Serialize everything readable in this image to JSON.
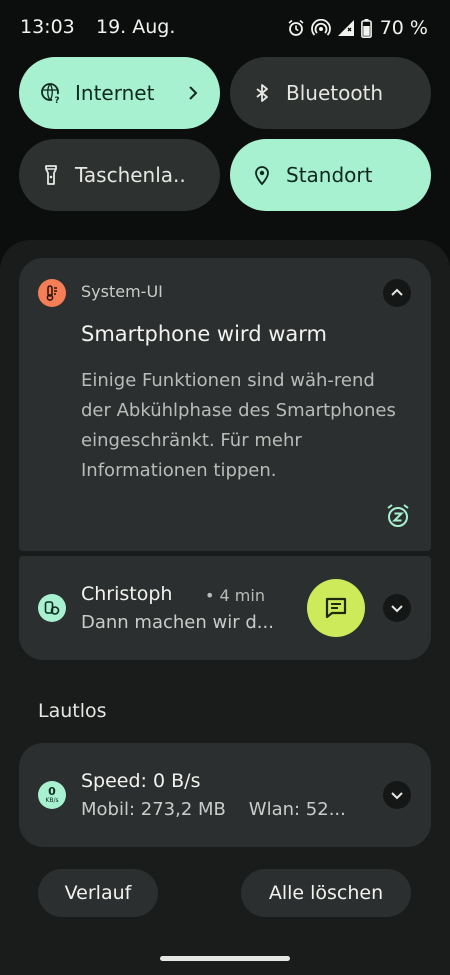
{
  "status_bar": {
    "time": "13:03",
    "date": "19. Aug.",
    "battery_percent": "70 %",
    "icons": [
      "alarm-icon",
      "hotspot-icon",
      "signal-icon",
      "battery-icon"
    ]
  },
  "quick_settings": {
    "tiles": [
      {
        "label": "Internet",
        "icon": "globe-icon",
        "active": true
      },
      {
        "label": "Bluetooth",
        "icon": "bluetooth-icon",
        "active": false
      },
      {
        "label": "Taschenla..",
        "icon": "flashlight-icon",
        "active": false
      },
      {
        "label": "Standort",
        "icon": "location-pin-icon",
        "active": true
      }
    ]
  },
  "notifications": {
    "system": {
      "app_name": "System-UI",
      "title": "Smartphone wird warm",
      "body": "Einige Funktionen sind wäh-rend der Abkühlphase des Smartphones eingeschränkt. Für mehr Informationen tippen."
    },
    "message": {
      "sender": "Christoph",
      "time": "• 4 min",
      "preview": "Dann machen wir d..."
    },
    "silent_section_label": "Lautlos",
    "speed": {
      "icon_value": "0",
      "icon_unit": "KB/s",
      "title": "Speed: 0 B/s",
      "detail": "Mobil: 273,2 MB    Wlan: 52..."
    }
  },
  "footer": {
    "history_label": "Verlauf",
    "clear_all_label": "Alle löschen"
  },
  "colors": {
    "accent": "#a7f1d0",
    "reply_button": "#ccea59",
    "system_icon": "#f57e56"
  }
}
